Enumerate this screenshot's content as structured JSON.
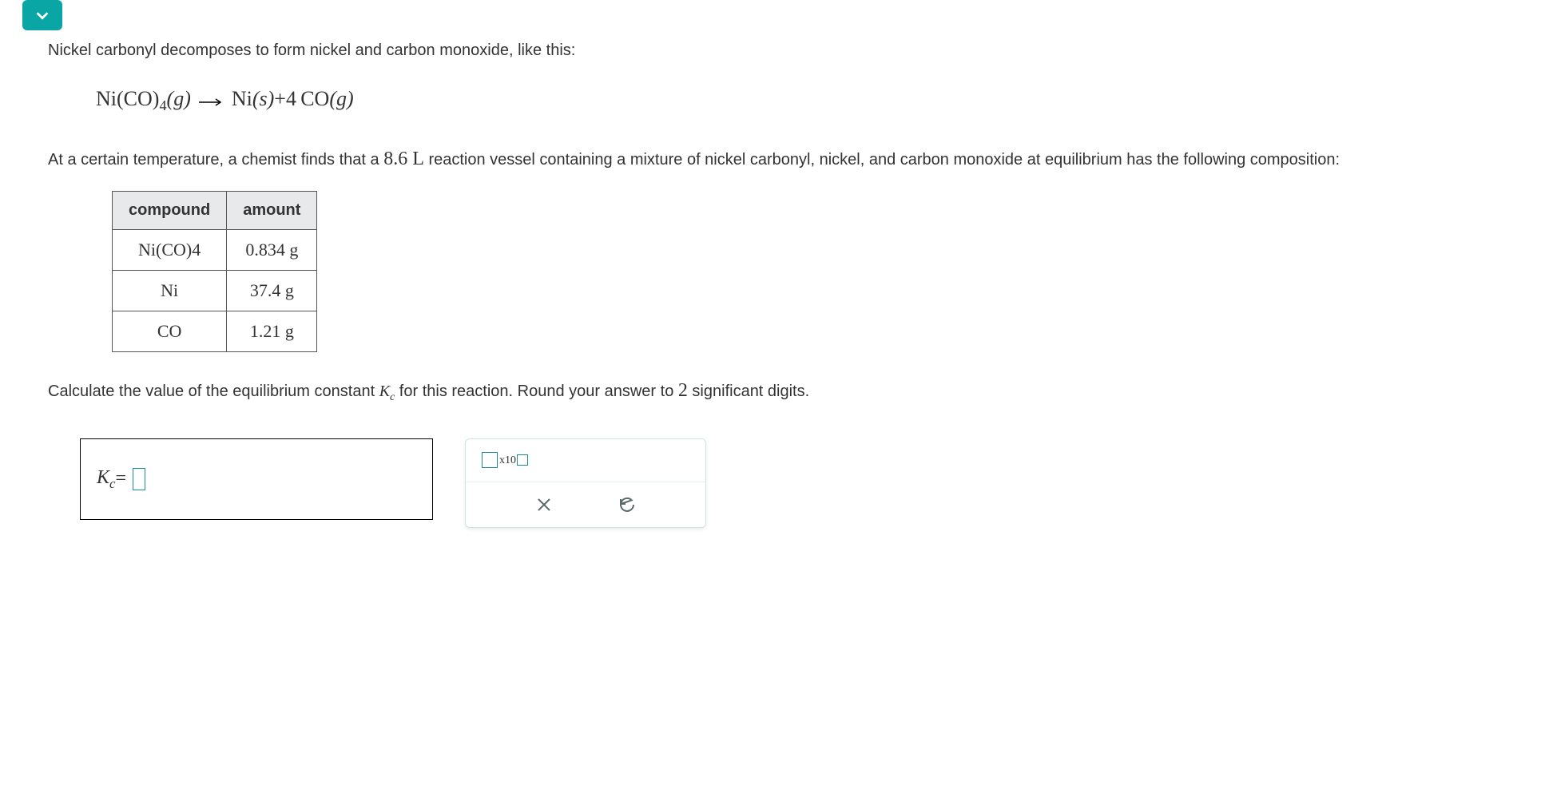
{
  "intro": "Nickel carbonyl decomposes to form nickel and carbon monoxide, like this:",
  "equation": {
    "reactant": "Ni(CO)",
    "reactant_sub": "4",
    "reactant_phase": "(g)",
    "product1": "Ni",
    "product1_phase": "(s)",
    "plus": "+",
    "coef": "4",
    "product2": "CO",
    "product2_phase": "(g)"
  },
  "context_pre": "At a certain temperature, a chemist finds that a ",
  "volume": "8.6 L",
  "context_post": " reaction vessel containing a mixture of nickel carbonyl, nickel, and carbon monoxide at equilibrium has the following composition:",
  "table": {
    "headers": {
      "compound": "compound",
      "amount": "amount"
    },
    "rows": [
      {
        "compound_html": "Ni(CO)<sub>4</sub>",
        "compound_plain": "Ni(CO)4",
        "amount": "0.834 g"
      },
      {
        "compound_html": "Ni",
        "compound_plain": "Ni",
        "amount": "37.4 g"
      },
      {
        "compound_html": "CO",
        "compound_plain": "CO",
        "amount": "1.21 g"
      }
    ]
  },
  "prompt_pre": "Calculate the value of the equilibrium constant ",
  "kc_symbol": "K",
  "kc_sub": "c",
  "prompt_mid": " for this reaction. Round your answer to ",
  "sig_digits": "2",
  "prompt_post": " significant digits.",
  "answer": {
    "label_k": "K",
    "label_sub": "c",
    "equals": " = "
  },
  "tools": {
    "sci_x10": "x10"
  },
  "chart_data": {
    "type": "table",
    "title": "Equilibrium composition",
    "columns": [
      "compound",
      "amount"
    ],
    "rows": [
      [
        "Ni(CO)4",
        "0.834 g"
      ],
      [
        "Ni",
        "37.4 g"
      ],
      [
        "CO",
        "1.21 g"
      ]
    ]
  }
}
